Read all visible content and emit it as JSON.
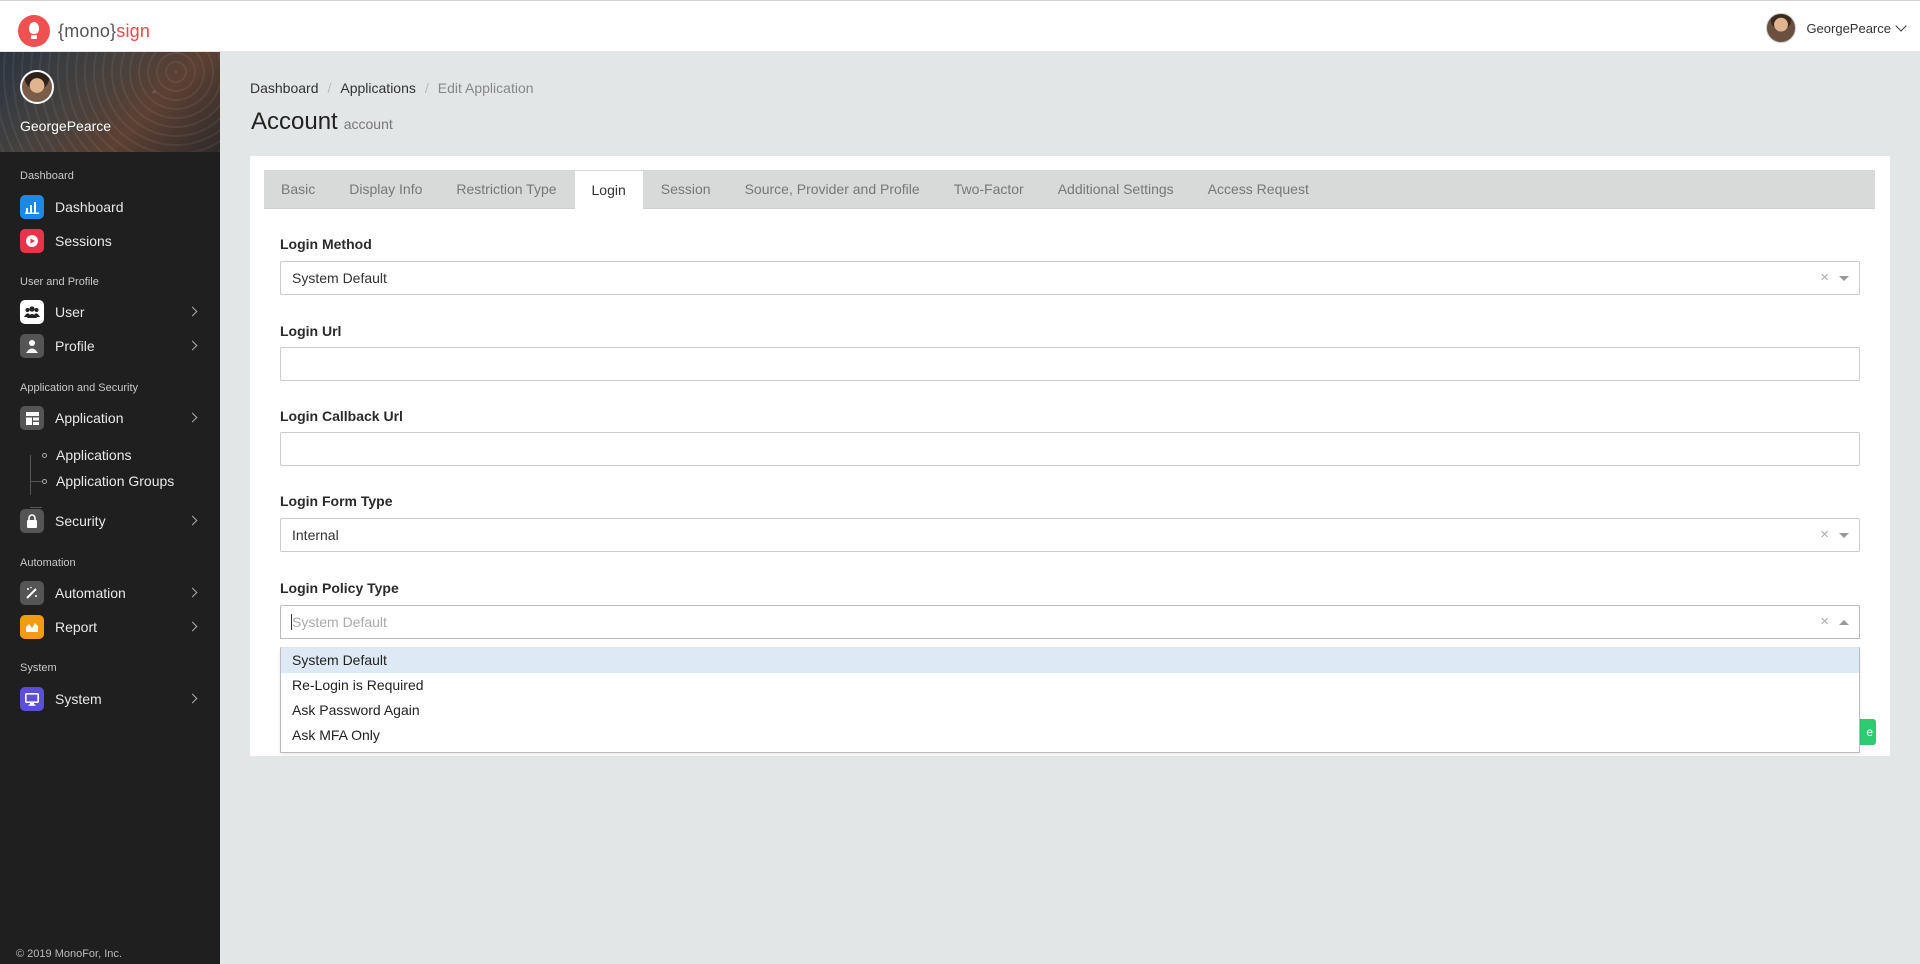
{
  "topbar": {
    "logo_prefix": "{mono}",
    "logo_suffix": "sign",
    "username": "GeorgePearce"
  },
  "sidebar": {
    "username": "GeorgePearce",
    "sections": {
      "dashboard": "Dashboard",
      "user_profile": "User and Profile",
      "app_security": "Application and Security",
      "automation": "Automation",
      "system": "System"
    },
    "items": {
      "dashboard": "Dashboard",
      "sessions": "Sessions",
      "user": "User",
      "profile": "Profile",
      "application": "Application",
      "applications": "Applications",
      "application_groups": "Application Groups",
      "security": "Security",
      "automation": "Automation",
      "report": "Report",
      "system": "System"
    },
    "icon_colors": {
      "dashboard": "#1e88e5",
      "sessions": "#e8334a",
      "user": "#ffffff",
      "profile": "#555555",
      "application": "#555555",
      "security": "#555555",
      "automation": "#555555",
      "report": "#f39c12",
      "system": "#5b4fd6"
    },
    "footer": "© 2019 MonoFor, Inc."
  },
  "breadcrumb": {
    "home": "Dashboard",
    "parent": "Applications",
    "current": "Edit Application"
  },
  "page": {
    "title": "Account",
    "subtitle": "account"
  },
  "tabs": {
    "basic": "Basic",
    "display_info": "Display Info",
    "restriction_type": "Restriction Type",
    "login": "Login",
    "session": "Session",
    "source": "Source, Provider and Profile",
    "two_factor": "Two-Factor",
    "additional": "Additional Settings",
    "access_request": "Access Request"
  },
  "form": {
    "login_method": {
      "label": "Login Method",
      "value": "System Default"
    },
    "login_url": {
      "label": "Login Url",
      "value": ""
    },
    "login_callback_url": {
      "label": "Login Callback Url",
      "value": ""
    },
    "login_form_type": {
      "label": "Login Form Type",
      "value": "Internal"
    },
    "login_policy_type": {
      "label": "Login Policy Type",
      "placeholder": "System Default",
      "options": [
        "System Default",
        "Re-Login is Required",
        "Ask Password Again",
        "Ask MFA Only"
      ]
    }
  },
  "actions": {
    "save_partial": "e"
  }
}
